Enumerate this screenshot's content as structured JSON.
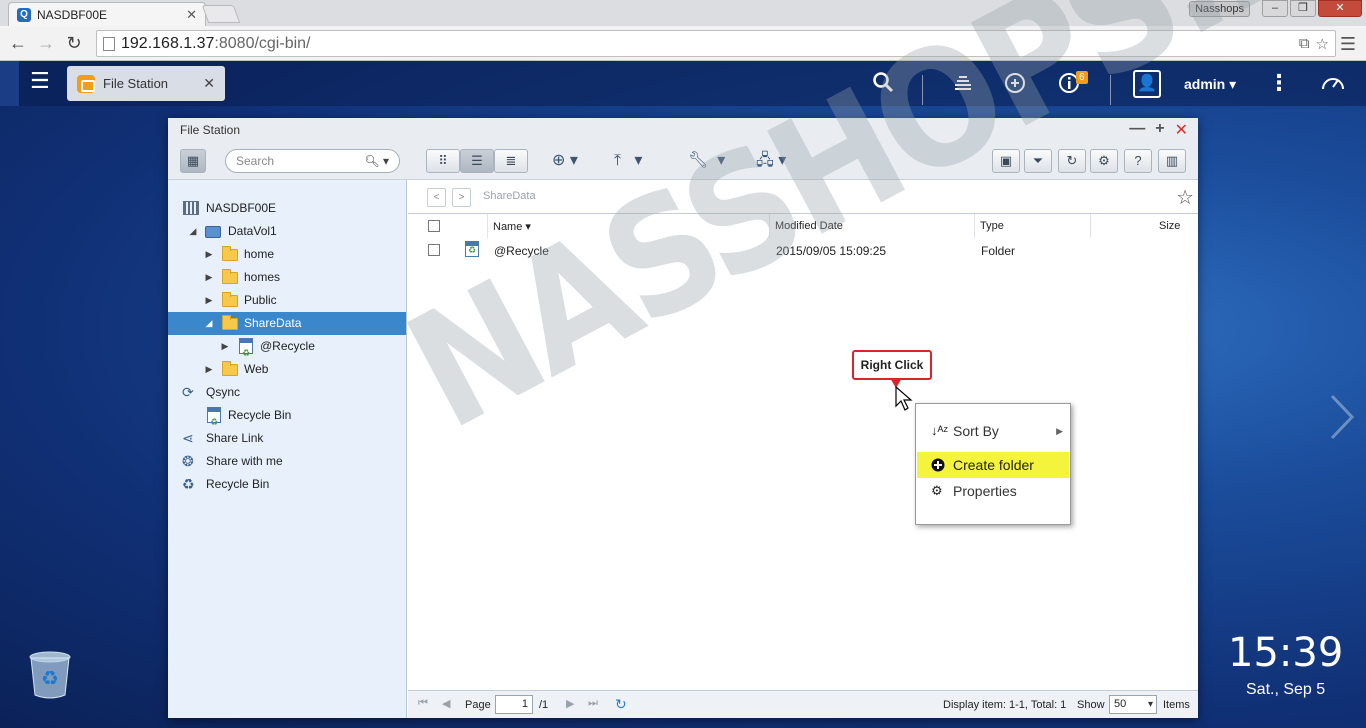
{
  "browser": {
    "tab_title": "NASDBF00E",
    "profile": "Nasshops",
    "url_host": "192.168.1.37",
    "url_path": ":8080/cgi-bin/"
  },
  "qts": {
    "app_tab": "File Station",
    "notification_count": "6",
    "user": "admin"
  },
  "window": {
    "title": "File Station",
    "search_placeholder": "Search"
  },
  "tree": [
    {
      "label": "NASDBF00E",
      "icon": "nas-icon"
    },
    {
      "label": "DataVol1",
      "icon": "volume-icon"
    },
    {
      "label": "home",
      "icon": "folder-icon"
    },
    {
      "label": "homes",
      "icon": "folder-icon"
    },
    {
      "label": "Public",
      "icon": "folder-icon"
    },
    {
      "label": "ShareData",
      "icon": "folder-icon",
      "selected": true
    },
    {
      "label": "@Recycle",
      "icon": "recycle-bin-icon"
    },
    {
      "label": "Web",
      "icon": "folder-icon"
    },
    {
      "label": "Qsync",
      "icon": "qsync-icon"
    },
    {
      "label": "Recycle Bin",
      "icon": "recycle-bin-icon"
    },
    {
      "label": "Share Link",
      "icon": "share-icon"
    },
    {
      "label": "Share with me",
      "icon": "share-with-me-icon"
    },
    {
      "label": "Recycle Bin",
      "icon": "recycle-icon"
    }
  ],
  "path": "ShareData",
  "columns": {
    "name": "Name",
    "modified": "Modified Date",
    "type": "Type",
    "size": "Size"
  },
  "files": [
    {
      "name": "@Recycle",
      "modified": "2015/09/05 15:09:25",
      "type": "Folder",
      "size": ""
    }
  ],
  "callout": "Right Click",
  "context_menu": {
    "sort_by": "Sort By",
    "create_folder": "Create folder",
    "properties": "Properties"
  },
  "status": {
    "page_label": "Page",
    "page_value": "1",
    "page_total": "/1",
    "display_info": "Display item: 1-1, Total: 1",
    "show_label": "Show",
    "show_value": "50",
    "items_label": "Items"
  },
  "watermark": "NASSHOPS.net",
  "desktop": {
    "time": "15:39",
    "date": "Sat., Sep 5"
  },
  "colors": {
    "accent": "#3b87cc",
    "highlight": "#f4f43c",
    "callout_border": "#d7262a",
    "badge": "#f29b1d"
  }
}
